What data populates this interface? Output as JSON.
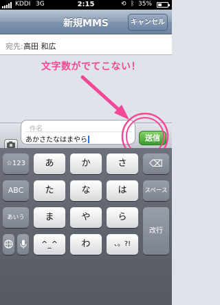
{
  "status_bar": {
    "carrier": "KDDI",
    "network": "3G",
    "time": "2:15",
    "rotation_icon": "rotation-lock-icon",
    "bluetooth_icon": "bluetooth-icon",
    "battery_percent": "35%",
    "battery_level": 0.35
  },
  "nav": {
    "title": "新規MMS",
    "cancel_label": "キャンセル"
  },
  "to_field": {
    "label": "宛先:",
    "value": "高田 和広"
  },
  "annotation": {
    "text": "文字数がでてこない！",
    "color": "#f24895"
  },
  "compose": {
    "subject_placeholder": "件名",
    "message_text": "あかさたなはまやら",
    "send_label": "送信",
    "camera_icon": "camera-icon"
  },
  "keyboard": {
    "row1": [
      "☆123",
      "あ",
      "か",
      "さ",
      "⌫"
    ],
    "row2": [
      "ABC",
      "た",
      "な",
      "は",
      "スペース"
    ],
    "row3": [
      "あいう",
      "ま",
      "や",
      "ら",
      "改行"
    ],
    "row4": [
      "globe",
      "mic",
      "^_^",
      "わ",
      "、。?!"
    ]
  },
  "colors": {
    "accent_pink": "#f24895",
    "send_green": "#3a9a2b",
    "nav_blue": "#7f93ad"
  }
}
